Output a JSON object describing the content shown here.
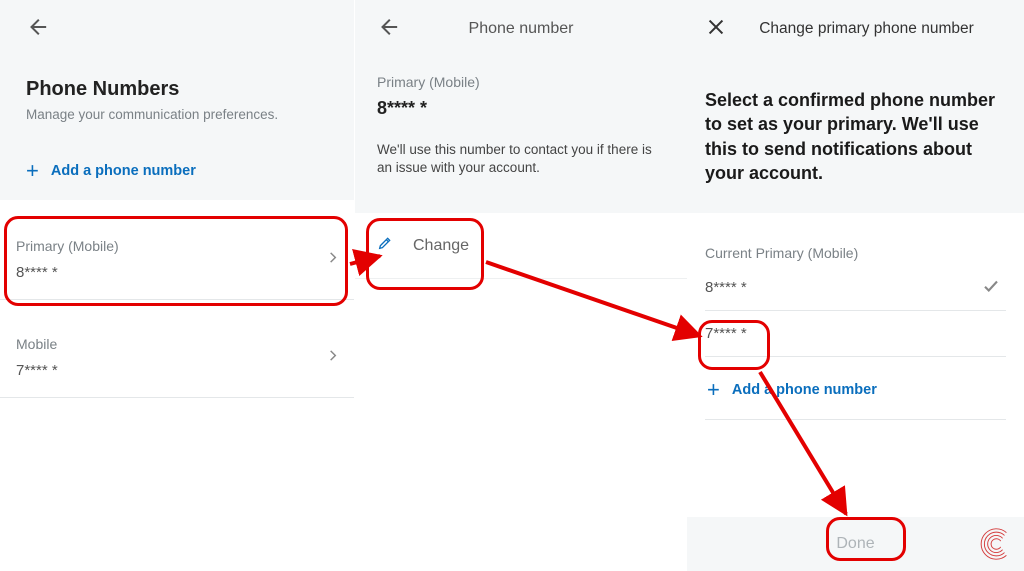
{
  "left": {
    "title": "Phone Numbers",
    "subtitle": "Manage your communication preferences.",
    "add_label": "Add a phone number",
    "items": [
      {
        "label": "Primary (Mobile)",
        "value": "8**** *"
      },
      {
        "label": "Mobile",
        "value": "7**** *"
      }
    ]
  },
  "mid": {
    "header": "Phone number",
    "primary_label": "Primary (Mobile)",
    "primary_value": "8**** *",
    "note": "We'll use this number to contact you if there is an issue with your account.",
    "change_label": "Change"
  },
  "right": {
    "header": "Change primary phone number",
    "headline": "Select a confirmed phone number to set as your primary. We'll use this to send notifications about your account.",
    "current_label": "Current Primary (Mobile)",
    "items": [
      {
        "value": "8**** *",
        "checked": true
      },
      {
        "value": "7**** *",
        "checked": false
      }
    ],
    "add_label": "Add a phone number",
    "done_label": "Done"
  }
}
